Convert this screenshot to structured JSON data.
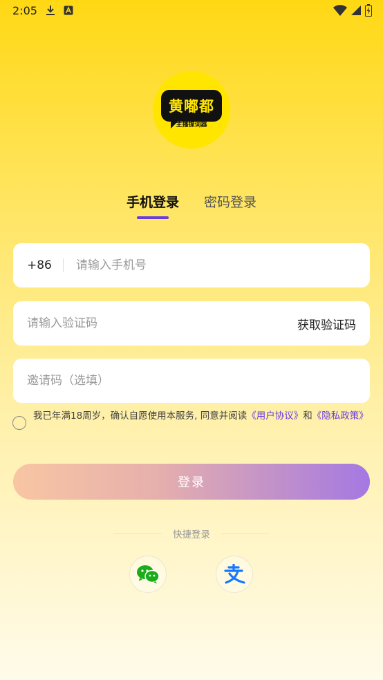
{
  "status_bar": {
    "time": "2:05",
    "icons": [
      "download-icon",
      "a-icon",
      "wifi-icon",
      "signal-icon",
      "battery-charging-icon"
    ]
  },
  "logo": {
    "title": "黄嘟都",
    "subtitle": "主播提词器",
    "brand_color": "#FFE500"
  },
  "tabs": [
    {
      "label": "手机登录",
      "active": true
    },
    {
      "label": "密码登录",
      "active": false
    }
  ],
  "form": {
    "country_code": "+86",
    "phone_placeholder": "请输入手机号",
    "code_placeholder": "请输入验证码",
    "get_code_label": "获取验证码",
    "invite_placeholder": "邀请码（选填）"
  },
  "agreement": {
    "prefix": "我已年满18周岁，确认自愿使用本服务, 同意并阅读",
    "user_agreement": "《用户协议》",
    "and": "和",
    "privacy_policy": "《隐私政策》",
    "checked": false
  },
  "login_button": "登录",
  "quick_login": {
    "label": "快捷登录",
    "methods": [
      "wechat-icon",
      "alipay-icon"
    ]
  },
  "colors": {
    "accent": "#6A3BDF",
    "wechat": "#1AAD19",
    "alipay": "#1677FF"
  }
}
